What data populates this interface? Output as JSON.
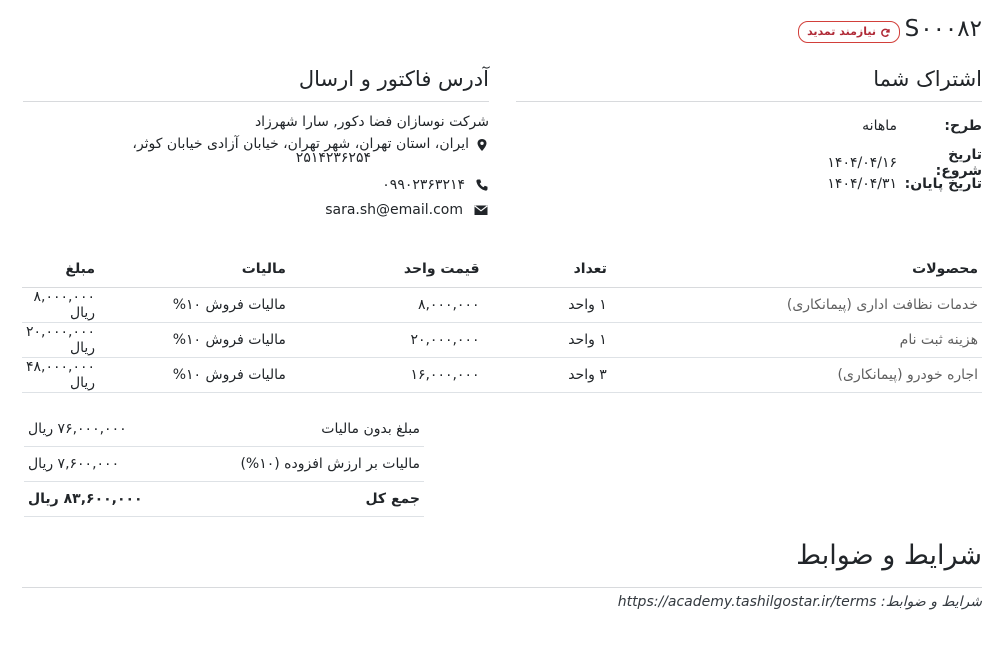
{
  "header": {
    "order_number": "S۰۰۰۸۲",
    "renew_badge": "نیازمند تمدید"
  },
  "subscription": {
    "title": "اشتراک شما",
    "rows": [
      {
        "label": "طرح:",
        "value": "ماهانه"
      },
      {
        "label": "تاریخ شروع:",
        "value": "۱۴۰۴/۰۴/۱۶"
      },
      {
        "label": "تاریخ پایان:",
        "value": "۱۴۰۴/۰۴/۳۱"
      }
    ]
  },
  "address": {
    "title": "آدرس فاکتور و ارسال",
    "company": "شرکت نوسازان فضا دکور, سارا شهرزاد",
    "address_line1": "ایران، استان تهران، شهر تهران، خیابان آزادی خیابان کوثر،",
    "address_line2": "۲۵۱۴۲۳۶۲۵۴",
    "phone": "۰۹۹۰۲۳۶۳۲۱۴",
    "email": "sara.sh@email.com",
    "icons": [
      "map-marker-icon",
      "phone-icon",
      "envelope-icon"
    ]
  },
  "lines_table": {
    "headers": {
      "product": "محصولات",
      "qty": "تعداد",
      "price": "قیمت واحد",
      "tax": "مالیات",
      "amount": "مبلغ"
    },
    "rows": [
      {
        "product": "خدمات نظافت اداری (پیمانکاری)",
        "qty": "۱ واحد",
        "price": "۸,۰۰۰,۰۰۰",
        "tax": "مالیات فروش ۱۰%",
        "amount": "۸,۰۰۰,۰۰۰ ریال"
      },
      {
        "product": "هزینه ثبت نام",
        "qty": "۱ واحد",
        "price": "۲۰,۰۰۰,۰۰۰",
        "tax": "مالیات فروش ۱۰%",
        "amount": "۲۰,۰۰۰,۰۰۰ ریال"
      },
      {
        "product": "اجاره خودرو (پیمانکاری)",
        "qty": "۳ واحد",
        "price": "۱۶,۰۰۰,۰۰۰",
        "tax": "مالیات فروش ۱۰%",
        "amount": "۴۸,۰۰۰,۰۰۰ ریال"
      }
    ]
  },
  "totals": {
    "untaxed_label": "مبلغ بدون مالیات",
    "untaxed_value": "۷۶,۰۰۰,۰۰۰ ریال",
    "vat_label": "مالیات بر ارزش افزوده (۱۰%)",
    "vat_value": "۷,۶۰۰,۰۰۰ ریال",
    "total_label": "جمع کل",
    "total_value": "۸۳,۶۰۰,۰۰۰ ریال"
  },
  "terms": {
    "title": "شرایط و ضوابط",
    "label": "شرایط و ضوابط:",
    "url": "https://academy.tashilgostar.ir/terms"
  },
  "colors": {
    "badge": "#d23f3a",
    "text": "#212529",
    "rule": "#d8dadd"
  }
}
